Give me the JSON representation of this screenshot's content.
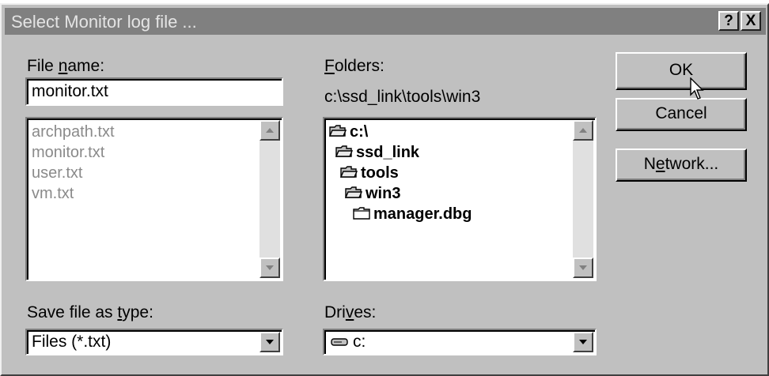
{
  "window": {
    "title": "Select Monitor log file ...",
    "help_button": "?",
    "close_button": "X"
  },
  "file_name": {
    "label_pre": "File ",
    "label_key": "n",
    "label_post": "ame:",
    "value": "monitor.txt",
    "files": [
      "archpath.txt",
      "monitor.txt",
      "user.txt",
      "vm.txt"
    ]
  },
  "folders": {
    "label_key": "F",
    "label_post": "olders:",
    "current_path": "c:\\ssd_link\\tools\\win3",
    "tree": [
      {
        "label": "c:\\",
        "state": "open"
      },
      {
        "label": "ssd_link",
        "state": "open"
      },
      {
        "label": "tools",
        "state": "open"
      },
      {
        "label": "win3",
        "state": "open"
      },
      {
        "label": "manager.dbg",
        "state": "closed"
      }
    ]
  },
  "save_type": {
    "label_pre": "Save file as ",
    "label_key": "t",
    "label_post": "ype:",
    "value": "Files (*.txt)"
  },
  "drives": {
    "label_pre": "Dri",
    "label_key": "v",
    "label_post": "es:",
    "value": "c:"
  },
  "buttons": {
    "ok": "OK",
    "cancel": "Cancel",
    "network_pre": "N",
    "network_key": "e",
    "network_post": "twork..."
  }
}
